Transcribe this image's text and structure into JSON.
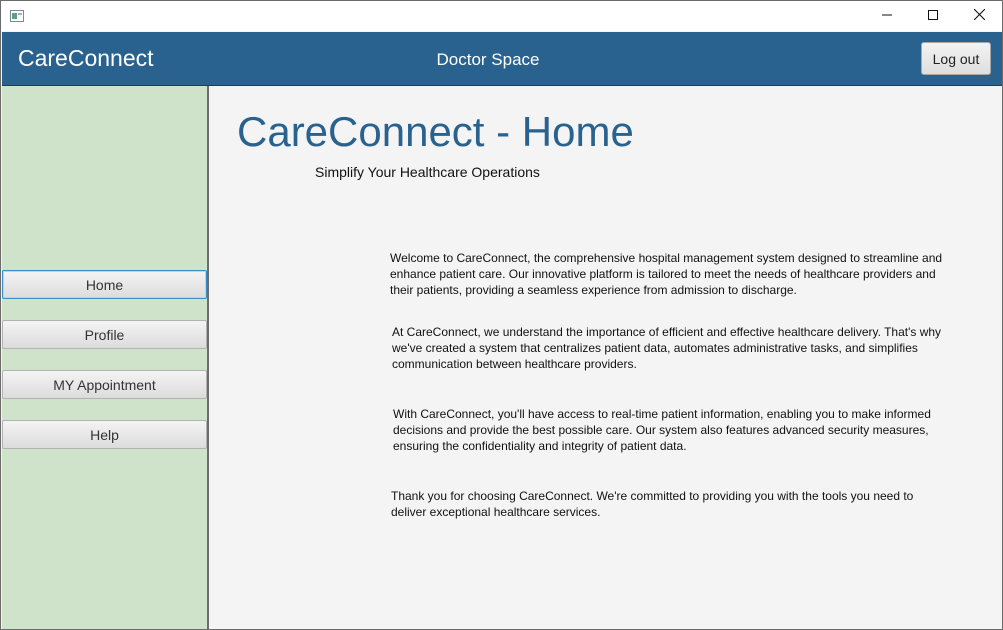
{
  "window": {
    "icon": "app-window-icon",
    "controls": {
      "minimize_icon": "minimize-icon",
      "maximize_icon": "maximize-icon",
      "close_icon": "close-icon"
    }
  },
  "header": {
    "brand": "CareConnect",
    "space_title": "Doctor Space",
    "logout_label": "Log out",
    "background_color": "#29628e"
  },
  "sidebar": {
    "background_color": "#cfe2ca",
    "items": [
      {
        "label": "Home",
        "active": true
      },
      {
        "label": "Profile",
        "active": false
      },
      {
        "label": "MY Appointment",
        "active": false
      },
      {
        "label": "Help",
        "active": false
      }
    ]
  },
  "main": {
    "title": "CareConnect - Home",
    "subtitle": "Simplify Your Healthcare Operations",
    "title_color": "#29628e",
    "paragraphs": [
      "Welcome to CareConnect, the comprehensive hospital management system designed to streamline and enhance patient care. Our innovative platform is tailored to meet the needs of healthcare providers and their patients, providing a seamless experience from admission to discharge.",
      "At CareConnect, we understand the importance of efficient and effective healthcare delivery. That's why we've created a system that centralizes patient data, automates administrative tasks, and simplifies communication between healthcare providers.",
      "With CareConnect, you'll have access to real-time patient information, enabling you to make informed decisions and provide the best possible care. Our system also features advanced security measures, ensuring the confidentiality and integrity of patient data.",
      "Thank you for choosing CareConnect. We're committed to providing you with the tools you need to deliver exceptional healthcare services."
    ]
  }
}
